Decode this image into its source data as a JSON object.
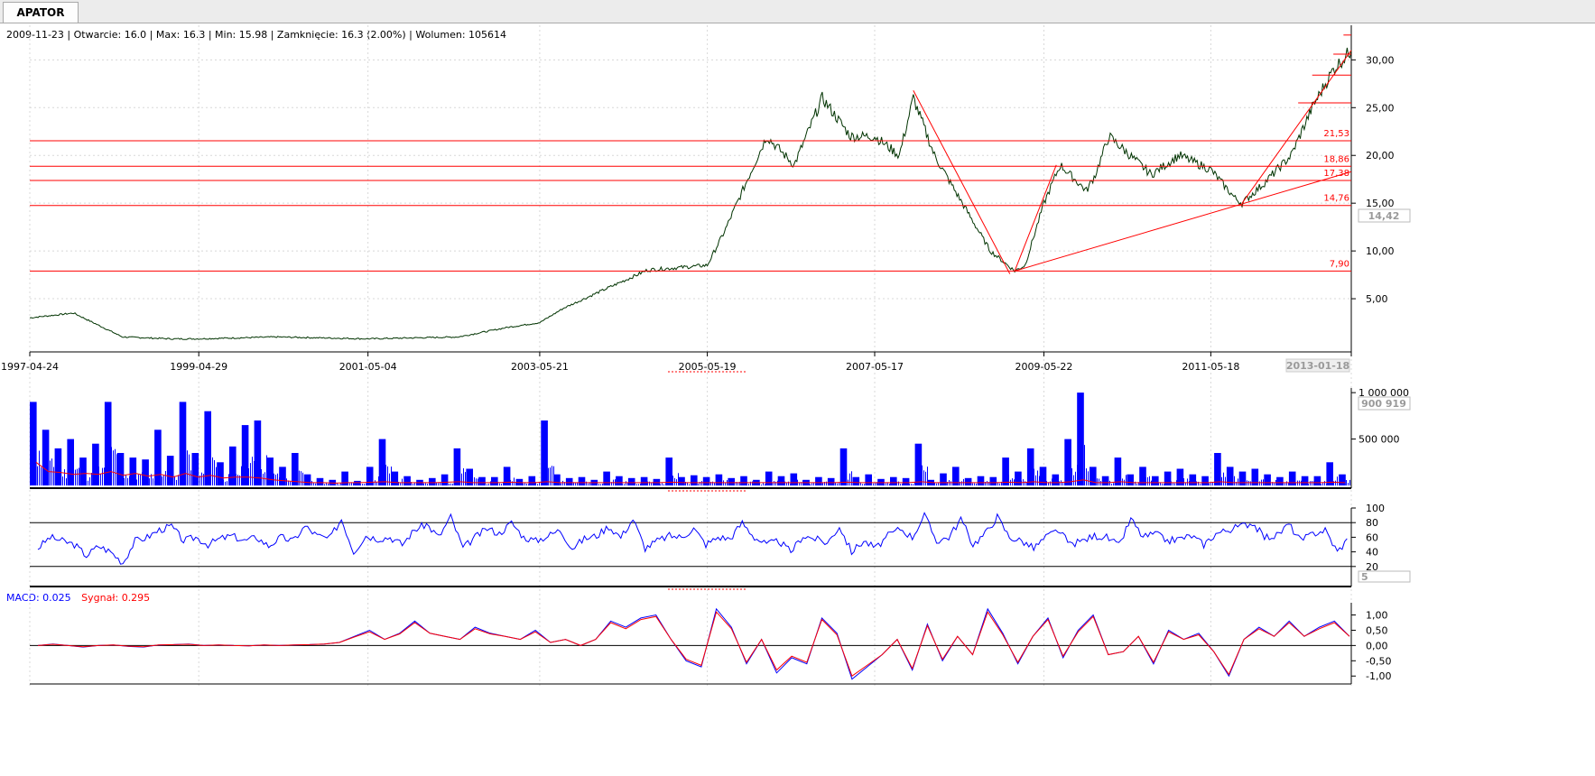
{
  "tab": {
    "label": "APATOR"
  },
  "info_line": "2009-11-23 | Otwarcie: 16.0 | Max: 16.3 | Min: 15.98 | Zamknięcie: 16.3 (2.00%) | Wolumen: 105614",
  "macd_legend": {
    "macd": "MACD: 0.025",
    "signal": "Sygnał: 0.295"
  },
  "colors": {
    "price": "#003300",
    "levels": "#ff0000",
    "volume": "#0000ff",
    "volume_ma": "#ff0000",
    "osc": "#0000ff",
    "macd": "#0000ff",
    "signal": "#ff0000"
  },
  "chart_data": [
    {
      "type": "line",
      "title": "",
      "x": [
        "1997-04-24",
        "1997-11-01",
        "1998-06-01",
        "1999-01-01",
        "1999-04-29",
        "2000-04-01",
        "2001-05-04",
        "2002-06-01",
        "2003-01-01",
        "2003-05-21",
        "2003-09-01",
        "2004-03-01",
        "2004-09-01",
        "2005-05-19",
        "2005-08-01",
        "2005-11-01",
        "2006-02-01",
        "2006-06-01",
        "2006-10-01",
        "2007-02-01",
        "2007-05-17",
        "2007-09-01",
        "2007-11-01",
        "2008-02-01",
        "2008-06-01",
        "2008-10-01",
        "2009-01-15",
        "2009-03-01",
        "2009-05-22",
        "2009-08-01",
        "2009-11-23",
        "2010-01-01",
        "2010-03-01",
        "2010-06-01",
        "2010-09-01",
        "2011-01-01",
        "2011-05-18",
        "2011-09-01",
        "2011-10-01",
        "2012-01-01",
        "2012-05-01",
        "2012-08-01",
        "2012-11-01",
        "2013-01-18"
      ],
      "series": [
        {
          "values": [
            3.0,
            3.5,
            1.0,
            0.8,
            0.8,
            1.0,
            0.8,
            1.0,
            2.0,
            2.5,
            4.0,
            6.0,
            8.0,
            8.5,
            12.0,
            17.0,
            22.0,
            19.0,
            26.0,
            22.0,
            22.0,
            20.0,
            26.0,
            20.0,
            15.0,
            10.0,
            7.9,
            8.5,
            15.0,
            19.0,
            16.3,
            18.0,
            22.0,
            20.0,
            18.0,
            20.0,
            18.5,
            15.5,
            15.0,
            17.0,
            20.0,
            25.0,
            29.0,
            31.0
          ]
        }
      ],
      "horizontal_levels": [
        {
          "value": 21.53,
          "label": "21,53"
        },
        {
          "value": 18.86,
          "label": "18,86"
        },
        {
          "value": 17.38,
          "label": "17,38"
        },
        {
          "value": 14.76,
          "label": "14,76"
        },
        {
          "value": 7.9,
          "label": "7,90"
        }
      ],
      "trend_lines": [
        {
          "from": [
            "2007-11-01",
            26.8
          ],
          "to": [
            "2008-12-25",
            7.6
          ]
        },
        {
          "from": [
            "2009-01-15",
            7.9
          ],
          "to": [
            "2009-07-15",
            19.0
          ]
        },
        {
          "from": [
            "2009-01-15",
            7.9
          ],
          "to": [
            "2013-01-18",
            18.3
          ]
        },
        {
          "from": [
            "2011-10-01",
            15.0
          ],
          "to": [
            "2013-01-18",
            31.0
          ]
        }
      ],
      "short_levels": [
        {
          "value": 25.5,
          "from": "2012-06-01",
          "to": "2013-01-18"
        },
        {
          "value": 28.4,
          "from": "2012-08-01",
          "to": "2013-01-18"
        },
        {
          "value": 30.6,
          "from": "2012-11-01",
          "to": "2013-01-18"
        },
        {
          "value": 32.6,
          "from": "2012-12-15",
          "to": "2013-01-18"
        }
      ],
      "ylim": [
        0,
        34
      ],
      "ytick_labels": [
        "30,00",
        "25,00",
        "20,00",
        "15,00",
        "10,00",
        "5,00"
      ],
      "xtick_labels": [
        "1997-04-24",
        "1999-04-29",
        "2001-05-04",
        "2003-05-21",
        "2005-05-19",
        "2007-05-17",
        "2009-05-22",
        "2011-05-18",
        "2013-01-18"
      ],
      "current_value_box": "14,42",
      "grid": true
    },
    {
      "type": "bar",
      "title": "",
      "series": [
        {
          "values": [
            900000,
            600000,
            400000,
            500000,
            300000,
            450000,
            900000,
            350000,
            300000,
            280000,
            600000,
            320000,
            900000,
            350000,
            800000,
            250000,
            420000,
            650000,
            700000,
            300000,
            200000,
            350000,
            120000,
            80000,
            60000,
            150000,
            50000,
            200000,
            500000,
            150000,
            100000,
            60000,
            80000,
            120000,
            400000,
            180000,
            90000,
            90000,
            200000,
            70000,
            100000,
            700000,
            120000,
            80000,
            90000,
            60000,
            150000,
            100000,
            80000,
            90000,
            70000,
            300000,
            90000,
            110000,
            90000,
            120000,
            80000,
            100000,
            60000,
            150000,
            100000,
            130000,
            60000,
            90000,
            80000,
            400000,
            90000,
            120000,
            70000,
            90000,
            80000,
            450000,
            60000,
            130000,
            200000,
            80000,
            100000,
            90000,
            300000,
            150000,
            400000,
            200000,
            120000,
            500000,
            1000000,
            200000,
            100000,
            300000,
            120000,
            200000,
            100000,
            150000,
            180000,
            120000,
            100000,
            350000,
            200000,
            150000,
            180000,
            120000,
            90000,
            150000,
            100000,
            100000,
            250000,
            120000
          ]
        },
        {
          "values": [
            250000,
            150000,
            140000,
            120000,
            130000,
            120000,
            150000,
            110000,
            130000,
            100000,
            120000,
            90000,
            130000,
            90000,
            110000,
            80000,
            90000,
            90000,
            80000,
            60000,
            50000,
            40000,
            30000,
            30000,
            25000,
            30000,
            30000,
            35000,
            40000,
            30000,
            30000,
            30000,
            30000,
            35000,
            40000,
            30000,
            30000,
            30000,
            35000,
            30000,
            30000,
            40000,
            30000,
            30000,
            30000,
            30000,
            30000,
            30000,
            30000,
            30000,
            30000,
            35000,
            30000,
            30000,
            30000,
            30000,
            30000,
            30000,
            30000,
            30000,
            30000,
            30000,
            30000,
            30000,
            30000,
            35000,
            30000,
            30000,
            30000,
            30000,
            30000,
            40000,
            30000,
            30000,
            30000,
            30000,
            30000,
            30000,
            35000,
            30000,
            40000,
            30000,
            30000,
            40000,
            60000,
            30000,
            30000,
            40000,
            30000,
            30000,
            30000,
            30000,
            30000,
            30000,
            30000,
            40000,
            30000,
            30000,
            30000,
            30000,
            30000,
            30000,
            30000,
            30000,
            35000,
            30000
          ]
        }
      ],
      "ytick_labels": [
        "1 000 000",
        "500 000"
      ],
      "current_value_box": "900 919"
    },
    {
      "type": "line",
      "title": "",
      "series": [
        {
          "values": [
            45,
            60,
            55,
            50,
            35,
            48,
            40,
            25,
            55,
            60,
            70,
            75,
            55,
            60,
            50,
            58,
            62,
            55,
            60,
            48,
            60,
            55,
            75,
            62,
            58,
            85,
            40,
            62,
            58,
            60,
            50,
            70,
            78,
            60,
            88,
            45,
            60,
            72,
            65,
            80,
            60,
            55,
            62,
            70,
            45,
            58,
            62,
            75,
            60,
            85,
            45,
            55,
            62,
            60,
            72,
            50,
            60,
            58,
            80,
            60,
            50,
            55,
            40,
            62,
            58,
            52,
            75,
            40,
            55,
            45,
            62,
            72,
            60,
            90,
            55,
            60,
            85,
            50,
            65,
            88,
            60,
            55,
            45,
            60,
            70,
            50,
            55,
            62,
            60,
            48,
            85,
            60,
            65,
            55,
            58,
            62,
            50,
            65,
            70,
            75,
            80,
            60,
            62,
            78,
            55,
            65,
            70,
            40,
            60
          ]
        }
      ],
      "ylim": [
        0,
        100
      ],
      "ytick_labels": [
        "100",
        "80",
        "60",
        "40",
        "20"
      ],
      "reference_lines": [
        80,
        20
      ],
      "current_value_box": "5"
    },
    {
      "type": "line",
      "title": "",
      "series": [
        {
          "values": [
            0,
            0.05,
            0,
            -0.05,
            0,
            0.02,
            -0.03,
            -0.05,
            0.02,
            0.03,
            0.05,
            0,
            0.02,
            0,
            -0.01,
            0.02,
            0,
            0.02,
            0.03,
            0.05,
            0.1,
            0.3,
            0.5,
            0.2,
            0.4,
            0.8,
            0.4,
            0.3,
            0.2,
            0.6,
            0.4,
            0.3,
            0.2,
            0.5,
            0.1,
            0.2,
            0,
            0.2,
            0.8,
            0.6,
            0.9,
            1.0,
            0.2,
            -0.5,
            -0.7,
            1.2,
            0.6,
            -0.6,
            0.2,
            -0.9,
            -0.4,
            -0.6,
            0.9,
            0.4,
            -1.1,
            -0.7,
            -0.3,
            0.2,
            -0.8,
            0.7,
            -0.5,
            0.3,
            -0.3,
            1.2,
            0.4,
            -0.6,
            0.3,
            0.9,
            -0.4,
            0.5,
            1.0,
            -0.3,
            -0.2,
            0.3,
            -0.6,
            0.5,
            0.2,
            0.4,
            -0.2,
            -1.0,
            0.2,
            0.6,
            0.3,
            0.8,
            0.3,
            0.6,
            0.8,
            0.3
          ]
        },
        {
          "values": [
            0,
            0.04,
            0,
            -0.04,
            0,
            0.02,
            -0.02,
            -0.04,
            0.02,
            0.03,
            0.04,
            0,
            0.02,
            0,
            -0.01,
            0.02,
            0,
            0.02,
            0.03,
            0.05,
            0.1,
            0.28,
            0.45,
            0.2,
            0.38,
            0.75,
            0.4,
            0.3,
            0.2,
            0.55,
            0.38,
            0.3,
            0.2,
            0.45,
            0.1,
            0.2,
            0,
            0.2,
            0.75,
            0.55,
            0.85,
            0.95,
            0.2,
            -0.45,
            -0.65,
            1.1,
            0.55,
            -0.55,
            0.2,
            -0.8,
            -0.35,
            -0.55,
            0.85,
            0.35,
            -1.0,
            -0.65,
            -0.3,
            0.2,
            -0.75,
            0.65,
            -0.45,
            0.3,
            -0.3,
            1.1,
            0.35,
            -0.55,
            0.3,
            0.85,
            -0.35,
            0.45,
            0.95,
            -0.3,
            -0.2,
            0.3,
            -0.55,
            0.45,
            0.2,
            0.35,
            -0.2,
            -0.95,
            0.2,
            0.55,
            0.3,
            0.75,
            0.3,
            0.55,
            0.75,
            0.3
          ]
        }
      ],
      "ylim": [
        -1.2,
        1.4
      ],
      "ytick_labels": [
        "1,00",
        "0,50",
        "0,00",
        "-0,50",
        "-1,00"
      ]
    }
  ]
}
